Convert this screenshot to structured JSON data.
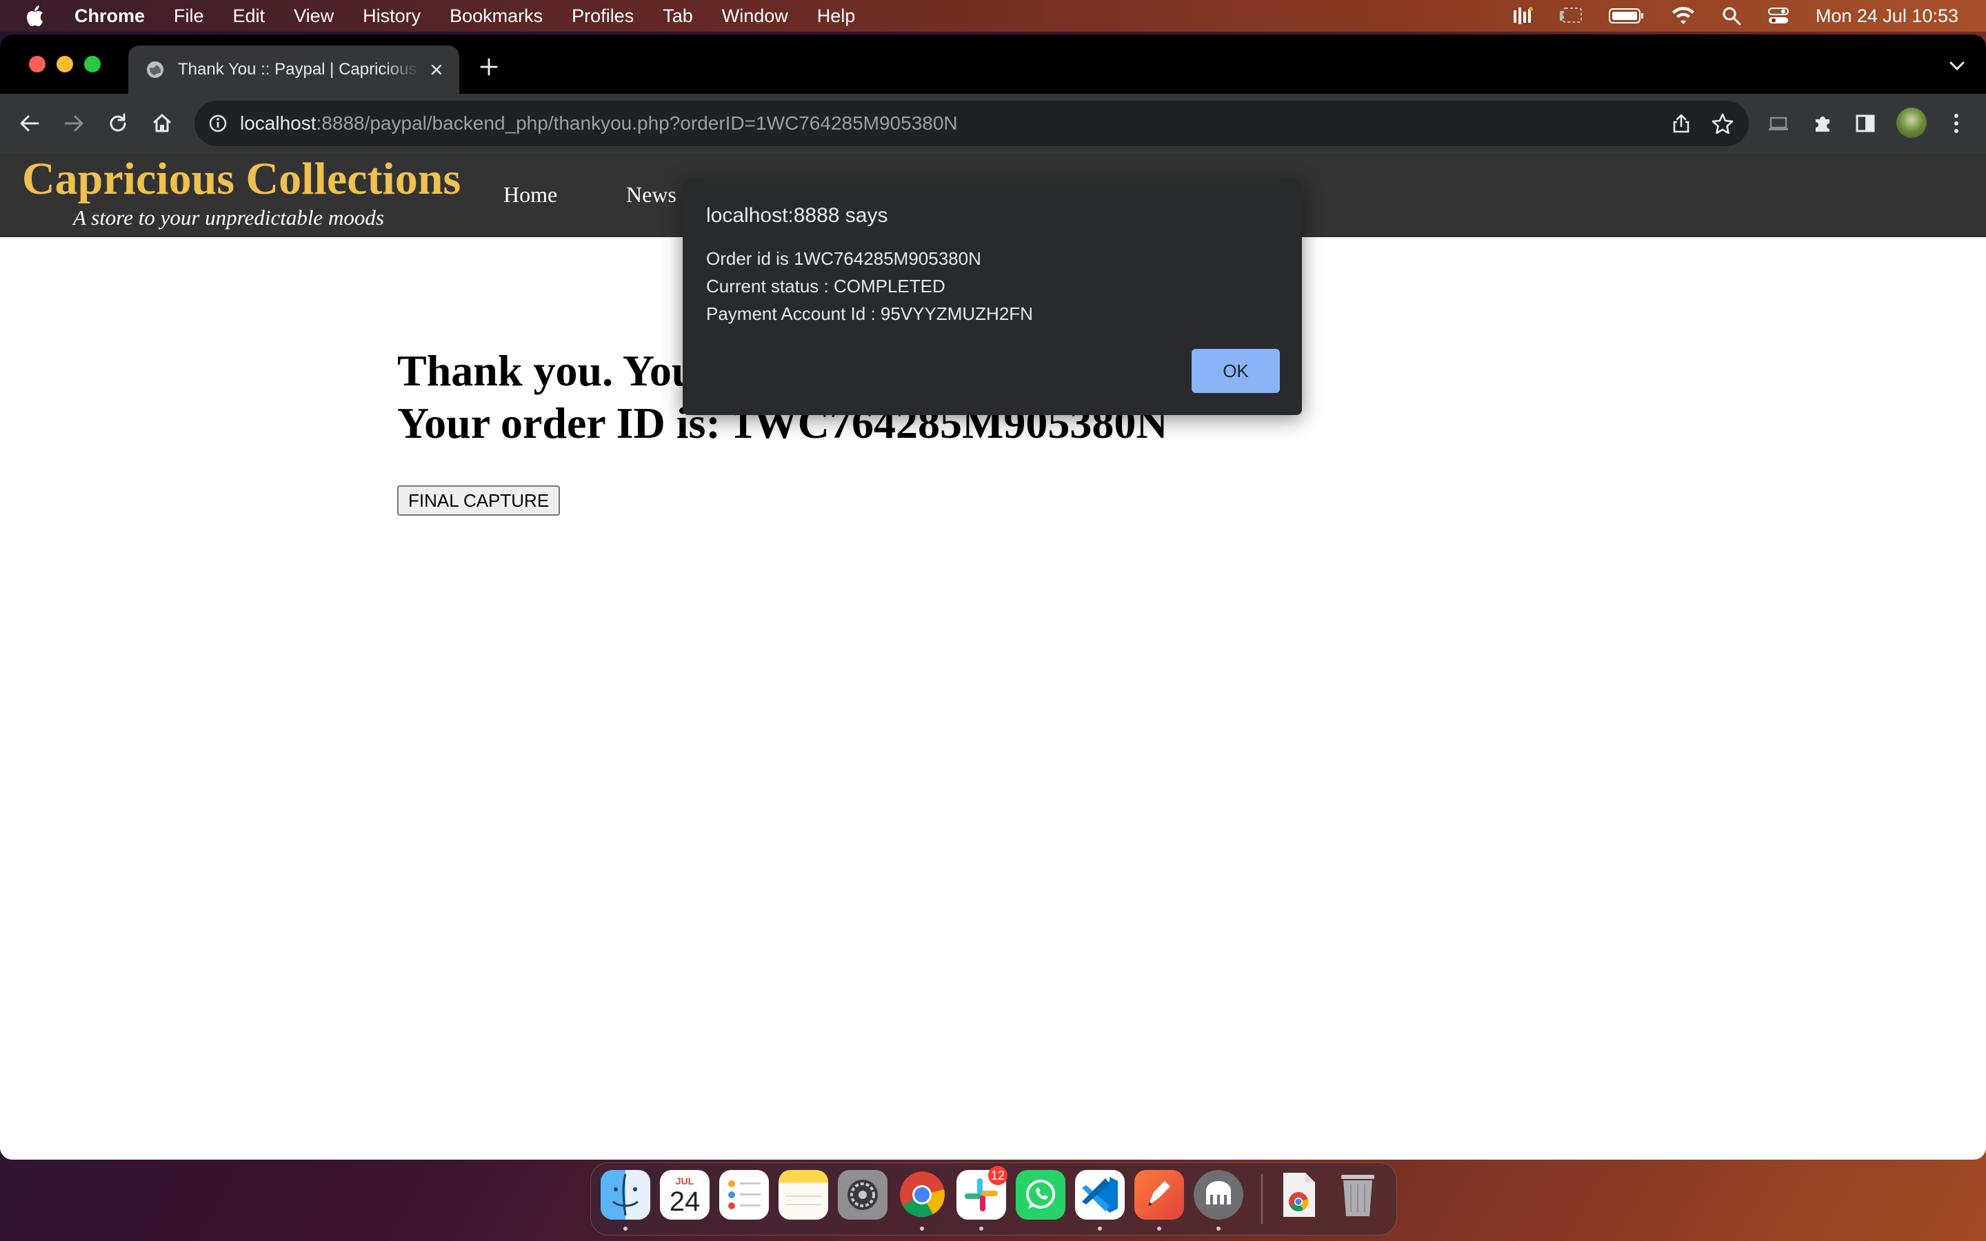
{
  "menubar": {
    "app_name": "Chrome",
    "items": [
      "File",
      "Edit",
      "View",
      "History",
      "Bookmarks",
      "Profiles",
      "Tab",
      "Window",
      "Help"
    ],
    "clock": "Mon 24 Jul  10:53"
  },
  "browser": {
    "tab_title": "Thank You :: Paypal | Capricious Collections",
    "url_host": "localhost",
    "url_rest": ":8888/paypal/backend_php/thankyou.php?orderID=1WC764285M905380N"
  },
  "site": {
    "logo": "Capricious Collections",
    "tagline": "A store to your unpredictable moods",
    "nav": [
      "Home",
      "News"
    ]
  },
  "content": {
    "thank_line": "Thank you. You",
    "order_line": "Your order ID is: 1WC764285M905380N",
    "final_capture_label": "FINAL CAPTURE"
  },
  "dialog": {
    "title": "localhost:8888 says",
    "line1": "Order id is 1WC764285M905380N",
    "line2": "Current status : COMPLETED",
    "line3": "Payment Account Id : 95VYYZMUZH2FN",
    "ok_label": "OK"
  },
  "dock": {
    "calendar_month": "JUL",
    "calendar_day": "24",
    "slack_badge": "12"
  }
}
